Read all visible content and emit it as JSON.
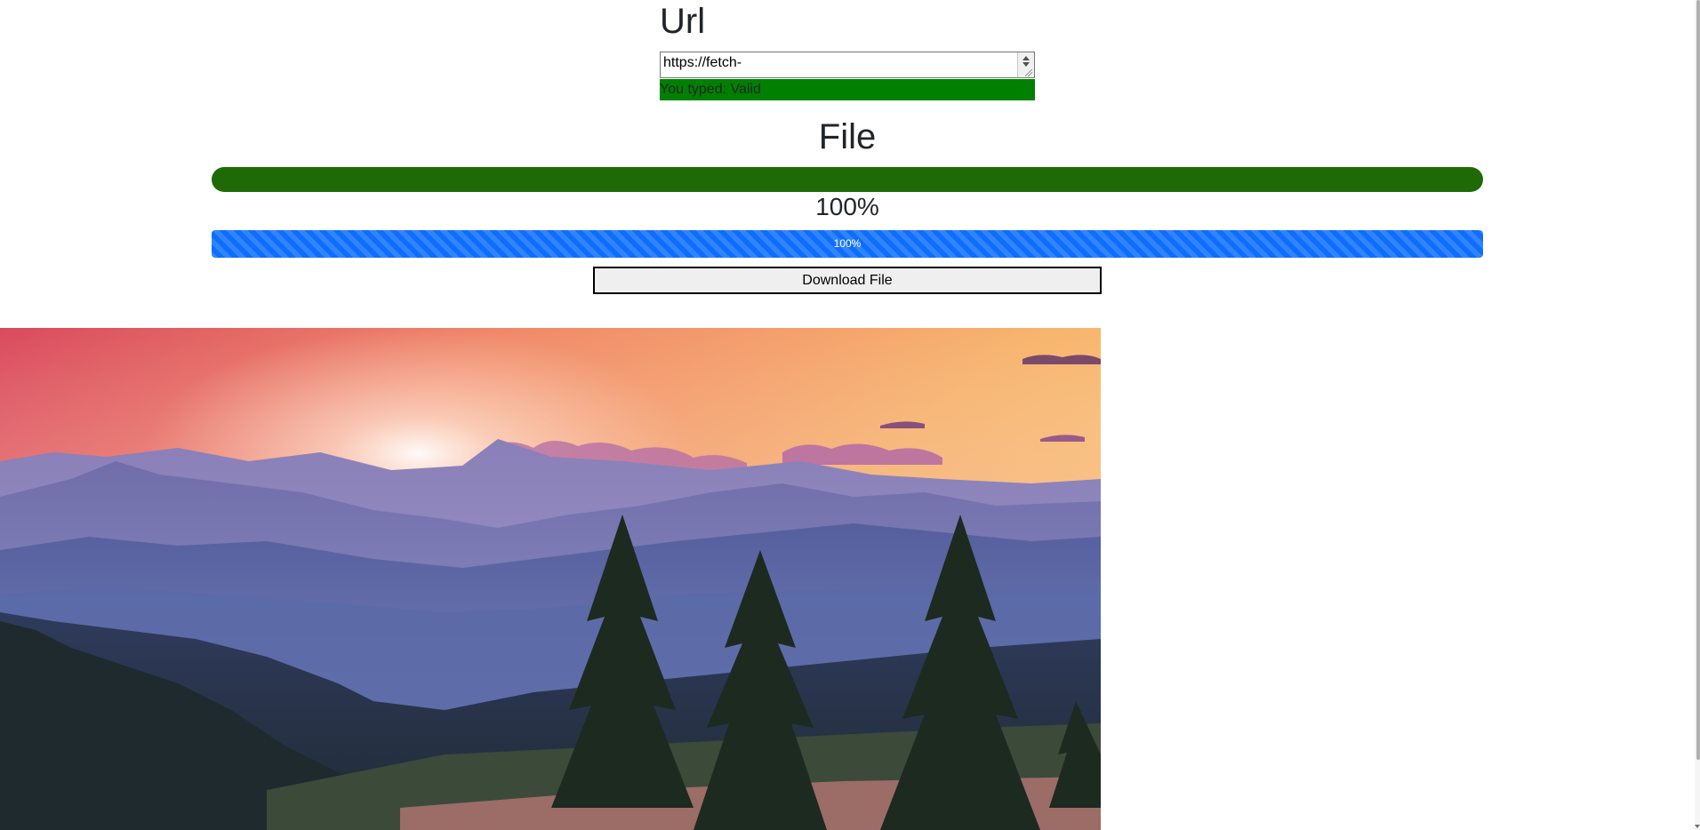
{
  "url_section": {
    "heading": "Url",
    "textarea_value": "https://fetch-",
    "validation_message": "You typed: Valid",
    "validation_color": "#008000"
  },
  "file_section": {
    "heading": "File",
    "status_bar_color": "#1f6a06",
    "percent_text": "100%",
    "progress": {
      "value_percent": 100,
      "label": "100%",
      "color": "#0d6efd"
    },
    "download_button_label": "Download File"
  },
  "image": {
    "description_icon": "landscape-image"
  }
}
